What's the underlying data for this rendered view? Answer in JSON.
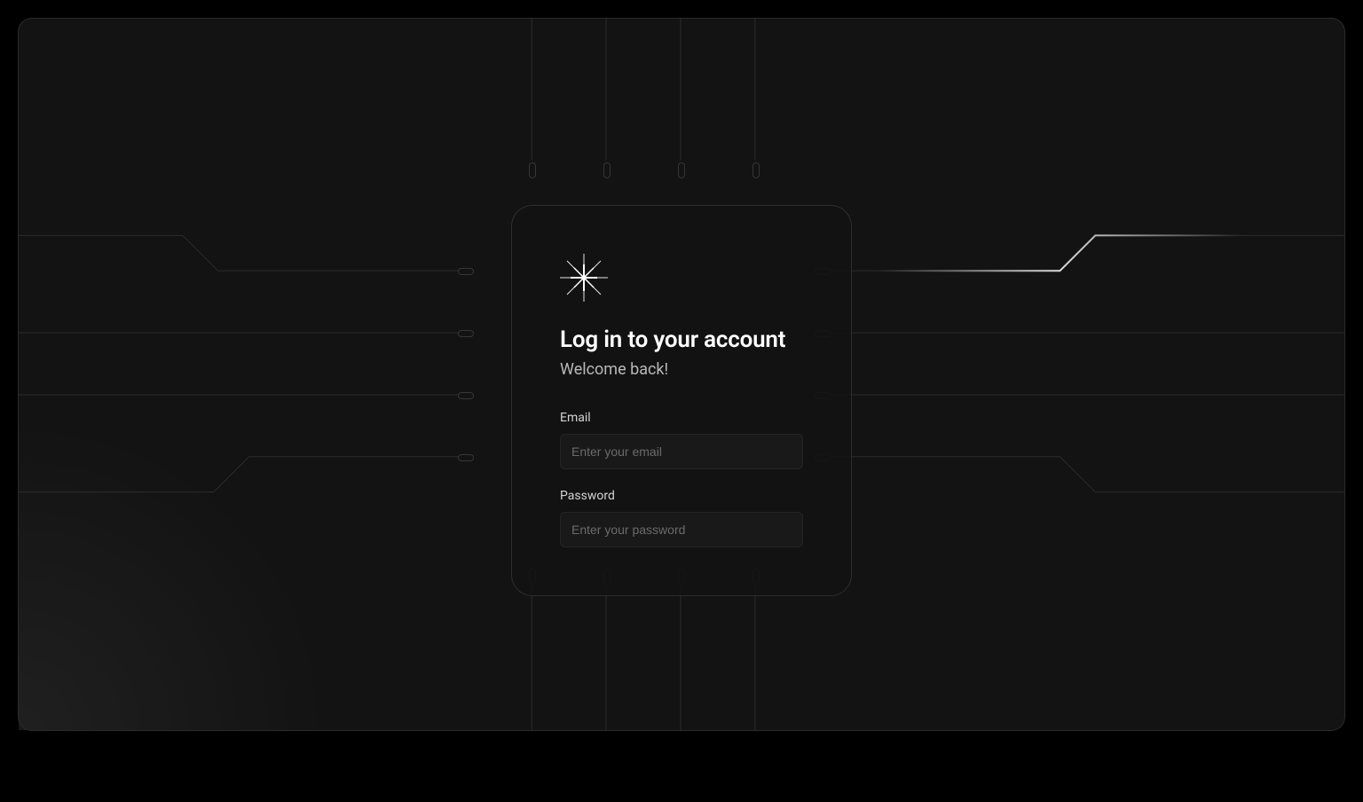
{
  "login": {
    "heading": "Log in to your account",
    "subheading": "Welcome back!",
    "email_label": "Email",
    "email_placeholder": "Enter your email",
    "email_value": "",
    "password_label": "Password",
    "password_placeholder": "Enter your password",
    "password_value": ""
  }
}
